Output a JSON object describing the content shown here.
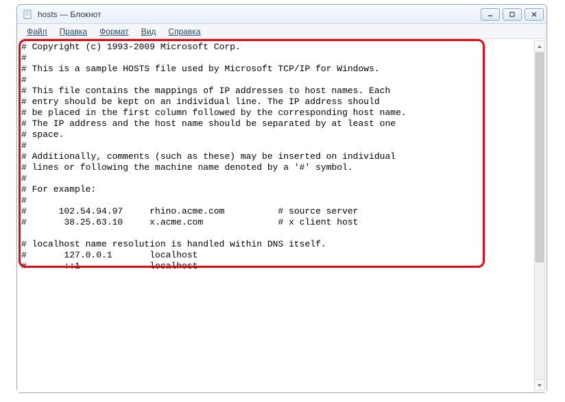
{
  "window": {
    "title": "hosts — Блокнот"
  },
  "menu": {
    "file": "Файл",
    "edit": "Правка",
    "format": "Формат",
    "view": "Вид",
    "help": "Справка"
  },
  "content": "# Copyright (c) 1993-2009 Microsoft Corp.\n#\n# This is a sample HOSTS file used by Microsoft TCP/IP for Windows.\n#\n# This file contains the mappings of IP addresses to host names. Each\n# entry should be kept on an individual line. The IP address should\n# be placed in the first column followed by the corresponding host name.\n# The IP address and the host name should be separated by at least one\n# space.\n#\n# Additionally, comments (such as these) may be inserted on individual\n# lines or following the machine name denoted by a '#' symbol.\n#\n# For example:\n#\n#      102.54.94.97     rhino.acme.com          # source server\n#       38.25.63.10     x.acme.com              # x client host\n\n# localhost name resolution is handled within DNS itself.\n#       127.0.0.1       localhost\n#       ::1             localhost"
}
